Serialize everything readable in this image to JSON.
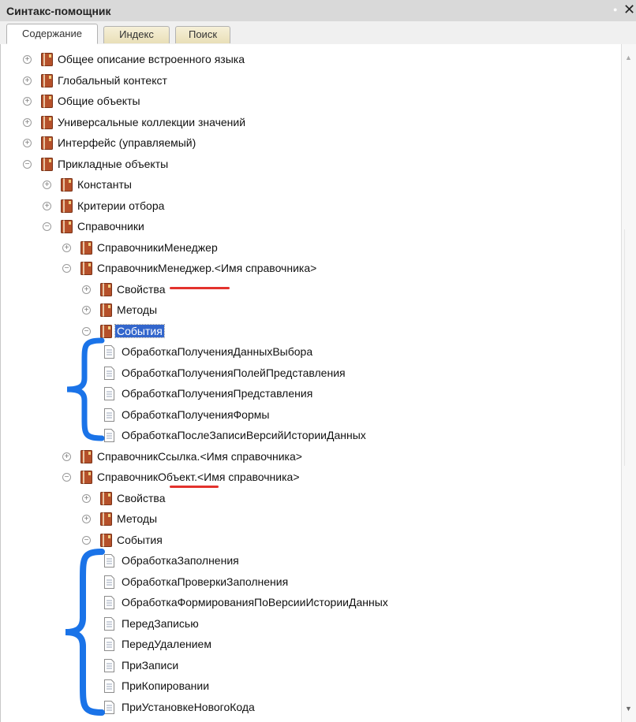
{
  "window": {
    "title": "Синтакс-помощник"
  },
  "tabs": [
    {
      "label": "Содержание",
      "active": true
    },
    {
      "label": "Индекс",
      "active": false
    },
    {
      "label": "Поиск",
      "active": false
    }
  ],
  "tree": [
    {
      "label": "Общее описание встроенного языка",
      "level": 0,
      "state": "collapsed",
      "icon": "book-icon"
    },
    {
      "label": "Глобальный контекст",
      "level": 0,
      "state": "collapsed",
      "icon": "book-icon"
    },
    {
      "label": "Общие объекты",
      "level": 0,
      "state": "collapsed",
      "icon": "book-icon"
    },
    {
      "label": "Универсальные коллекции значений",
      "level": 0,
      "state": "collapsed",
      "icon": "book-icon"
    },
    {
      "label": "Интерфейс (управляемый)",
      "level": 0,
      "state": "collapsed",
      "icon": "book-icon"
    },
    {
      "label": "Прикладные объекты",
      "level": 0,
      "state": "expanded",
      "icon": "book-icon"
    },
    {
      "label": "Константы",
      "level": 1,
      "state": "collapsed",
      "icon": "book-icon"
    },
    {
      "label": "Критерии отбора",
      "level": 1,
      "state": "collapsed",
      "icon": "book-icon"
    },
    {
      "label": "Справочники",
      "level": 1,
      "state": "expanded",
      "icon": "book-icon"
    },
    {
      "label": "СправочникиМенеджер",
      "level": 2,
      "state": "collapsed",
      "icon": "book-icon"
    },
    {
      "label": "СправочникМенеджер.<Имя справочника>",
      "level": 2,
      "state": "expanded",
      "icon": "book-icon"
    },
    {
      "label": "Свойства",
      "level": 3,
      "state": "collapsed",
      "icon": "book-icon"
    },
    {
      "label": "Методы",
      "level": 3,
      "state": "collapsed",
      "icon": "book-icon"
    },
    {
      "label": "События",
      "level": 3,
      "state": "expanded",
      "icon": "book-icon",
      "selected": true
    },
    {
      "label": "ОбработкаПолученияДанныхВыбора",
      "level": 4,
      "state": "leaf",
      "icon": "page-icon"
    },
    {
      "label": "ОбработкаПолученияПолейПредставления",
      "level": 4,
      "state": "leaf",
      "icon": "page-icon"
    },
    {
      "label": "ОбработкаПолученияПредставления",
      "level": 4,
      "state": "leaf",
      "icon": "page-icon"
    },
    {
      "label": "ОбработкаПолученияФормы",
      "level": 4,
      "state": "leaf",
      "icon": "page-icon"
    },
    {
      "label": "ОбработкаПослеЗаписиВерсийИсторииДанных",
      "level": 4,
      "state": "leaf",
      "icon": "page-icon"
    },
    {
      "label": "СправочникСсылка.<Имя справочника>",
      "level": 2,
      "state": "collapsed",
      "icon": "book-icon"
    },
    {
      "label": "СправочникОбъект.<Имя справочника>",
      "level": 2,
      "state": "expanded",
      "icon": "book-icon"
    },
    {
      "label": "Свойства",
      "level": 3,
      "state": "collapsed",
      "icon": "book-icon"
    },
    {
      "label": "Методы",
      "level": 3,
      "state": "collapsed",
      "icon": "book-icon"
    },
    {
      "label": "События",
      "level": 3,
      "state": "expanded",
      "icon": "book-icon"
    },
    {
      "label": "ОбработкаЗаполнения",
      "level": 4,
      "state": "leaf",
      "icon": "page-icon"
    },
    {
      "label": "ОбработкаПроверкиЗаполнения",
      "level": 4,
      "state": "leaf",
      "icon": "page-icon"
    },
    {
      "label": "ОбработкаФормированияПоВерсииИсторииДанных",
      "level": 4,
      "state": "leaf",
      "icon": "page-icon"
    },
    {
      "label": "ПередЗаписью",
      "level": 4,
      "state": "leaf",
      "icon": "page-icon"
    },
    {
      "label": "ПередУдалением",
      "level": 4,
      "state": "leaf",
      "icon": "page-icon"
    },
    {
      "label": "ПриЗаписи",
      "level": 4,
      "state": "leaf",
      "icon": "page-icon"
    },
    {
      "label": "ПриКопировании",
      "level": 4,
      "state": "leaf",
      "icon": "page-icon"
    },
    {
      "label": "ПриУстановкеНовогоКода",
      "level": 4,
      "state": "leaf",
      "icon": "page-icon"
    }
  ],
  "colors": {
    "book": "#b5502a",
    "selection": "#3366cc",
    "brace": "#1a73e8",
    "underline": "#e3322d"
  }
}
